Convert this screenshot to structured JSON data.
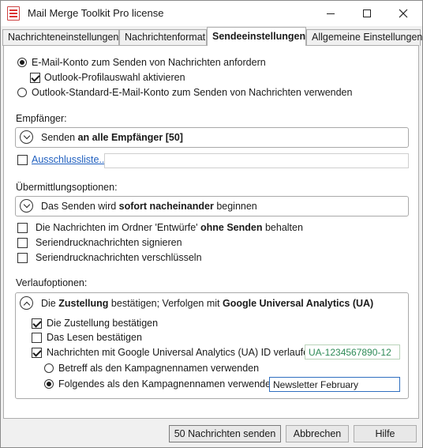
{
  "window": {
    "title": "Mail Merge Toolkit Pro license"
  },
  "tabs": [
    {
      "label": "Nachrichteneinstellungen",
      "active": false
    },
    {
      "label": "Nachrichtenformat",
      "active": false
    },
    {
      "label": "Sendeeinstellungen",
      "active": true
    },
    {
      "label": "Allgemeine Einstellungen",
      "active": false
    }
  ],
  "account": {
    "radio_request": "E-Mail-Konto zum Senden von Nachrichten anfordern",
    "check_profile": "Outlook-Profilauswahl aktivieren",
    "radio_default": "Outlook-Standard-E-Mail-Konto zum Senden von Nachrichten verwenden"
  },
  "recipients": {
    "heading": "Empfänger:",
    "summary_prefix": "Senden ",
    "summary_bold": "an alle Empfänger [50]",
    "exclude_link": "Ausschlussliste...",
    "exclude_value": ""
  },
  "delivery": {
    "heading": "Übermittlungsoptionen:",
    "summary_prefix": "Das Senden wird ",
    "summary_bold": "sofort nacheinander",
    "summary_suffix": " beginnen",
    "keep_drafts_prefix": "Die Nachrichten im Ordner 'Entwürfe' ",
    "keep_drafts_bold": "ohne Senden",
    "keep_drafts_suffix": " behalten",
    "sign": "Seriendrucknachrichten signieren",
    "encrypt": "Seriendrucknachrichten verschlüsseln"
  },
  "tracking": {
    "heading": "Verlaufoptionen:",
    "summary_p1": "Die ",
    "summary_b1": "Zustellung",
    "summary_p2": " bestätigen; Verfolgen mit ",
    "summary_b2": "Google Universal Analytics (UA)",
    "confirm_delivery": "Die Zustellung bestätigen",
    "confirm_read": "Das Lesen bestätigen",
    "ga_track": "Nachrichten mit Google Universal Analytics (UA) ID verlaufen",
    "ga_id": "UA-1234567890-12",
    "campaign_subject": "Betreff als den Kampagnennamen verwenden",
    "campaign_custom": "Folgendes als den Kampagnennamen verwenden:",
    "campaign_name": "Newsletter February"
  },
  "buttons": {
    "send": "50 Nachrichten senden",
    "cancel": "Abbrechen",
    "help": "Hilfe"
  }
}
